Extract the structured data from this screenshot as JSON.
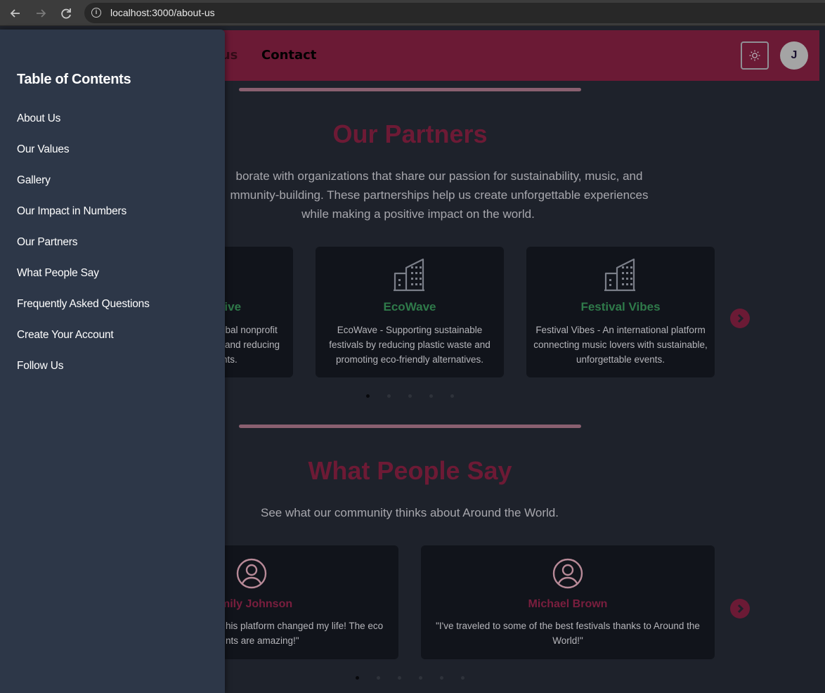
{
  "browser": {
    "url": "localhost:3000/about-us",
    "back_icon": "arrow-left-icon",
    "forward_icon": "arrow-right-icon",
    "reload_icon": "reload-icon",
    "site_info_icon": "info-icon"
  },
  "nav": {
    "about_partial": "t us",
    "contact": "Contact",
    "avatar_initial": "J",
    "theme_icon": "sun-icon"
  },
  "colors": {
    "brand": "#6b1a35",
    "sidebar_bg": "#2d3748",
    "page_bg": "#1e222b",
    "card_bg": "#11141b",
    "partner_title": "#2f7a4a",
    "person_name": "#7a1e3e"
  },
  "partners": {
    "title": "Our Partners",
    "description_lines": [
      "borate with organizations that share our passion for sustainability, music, and",
      "mmunity-building. These partnerships help us create unforgettable experiences",
      "while making a positive impact on the world."
    ],
    "cards": [
      {
        "title": "tiative",
        "desc_lines": [
          "lobal nonprofit",
          "and reducing",
          "nts."
        ],
        "icon": "building-icon"
      },
      {
        "title": "EcoWave",
        "desc_lines": [
          "EcoWave - Supporting sustainable",
          "festivals by reducing plastic waste and",
          "promoting eco-friendly alternatives."
        ],
        "icon": "building-icon"
      },
      {
        "title": "Festival Vibes",
        "desc_lines": [
          "Festival Vibes - An international platform",
          "connecting music lovers with sustainable,",
          "unforgettable events."
        ],
        "icon": "building-icon"
      }
    ],
    "dots_count": 5,
    "active_dot": 0,
    "next_icon": "chevron-right-icon"
  },
  "testimonials": {
    "title": "What People Say",
    "description": "See what our community thinks about Around the World.",
    "cards": [
      {
        "name": "mily Johnson",
        "quote_lines": [
          "his platform changed my life! The eco",
          "nts are amazing!\""
        ],
        "icon": "user-circle-icon"
      },
      {
        "name": "Michael Brown",
        "quote_lines": [
          "\"I've traveled to some of the best festivals thanks to Around the",
          "World!\""
        ],
        "icon": "user-circle-icon"
      }
    ],
    "dots_count": 6,
    "active_dot": 0,
    "next_icon": "chevron-right-icon"
  },
  "toc": {
    "title": "Table of Contents",
    "items": [
      "About Us",
      "Our Values",
      "Gallery",
      "Our Impact in Numbers",
      "Our Partners",
      "What People Say",
      "Frequently Asked Questions",
      "Create Your Account",
      "Follow Us"
    ]
  }
}
